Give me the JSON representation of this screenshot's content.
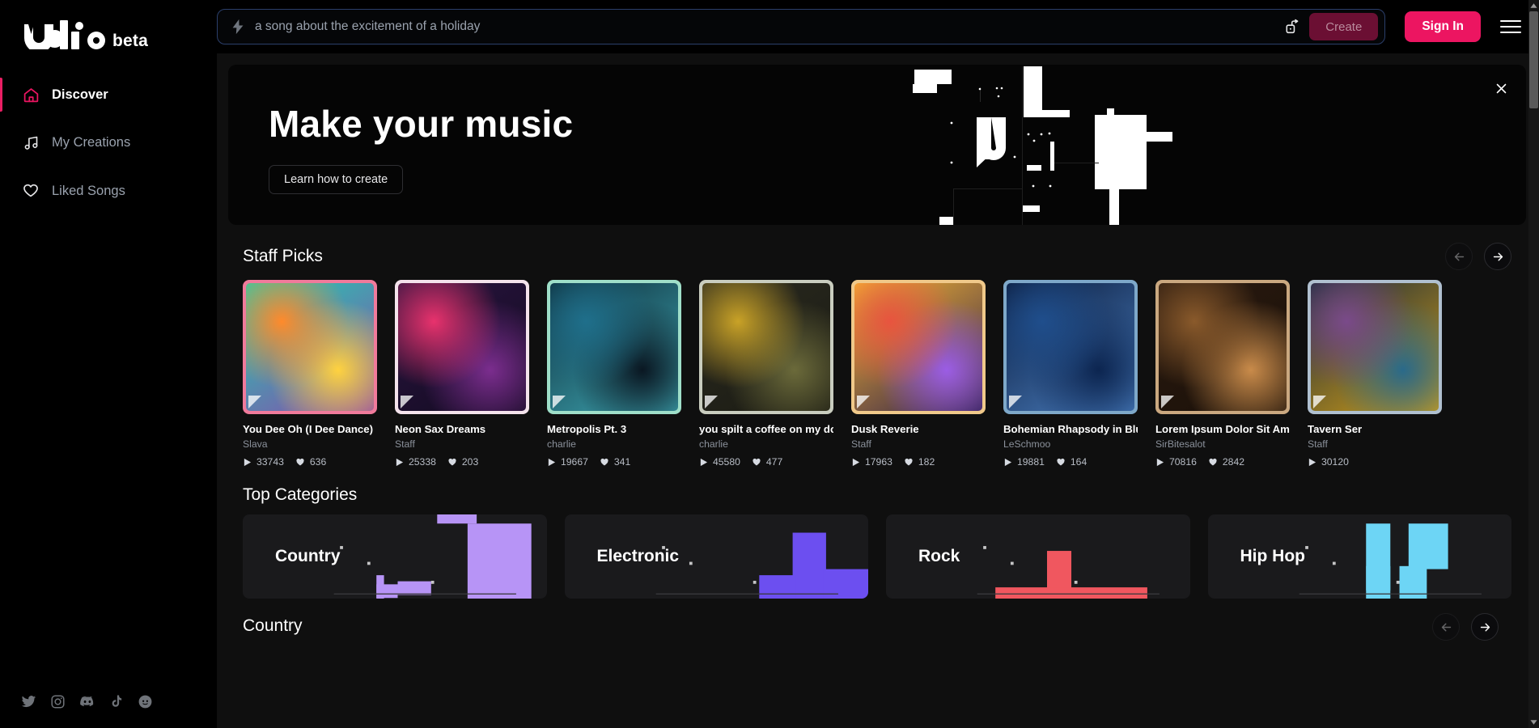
{
  "brand": {
    "name": "udio",
    "tag": "beta",
    "logo_icon": "udio-logo"
  },
  "sidebar": {
    "items": [
      {
        "label": "Discover",
        "icon": "home-icon",
        "active": true
      },
      {
        "label": "My Creations",
        "icon": "music-note-icon",
        "active": false
      },
      {
        "label": "Liked Songs",
        "icon": "heart-icon",
        "active": false
      }
    ],
    "social": [
      {
        "name": "twitter-icon"
      },
      {
        "name": "instagram-icon"
      },
      {
        "name": "discord-icon"
      },
      {
        "name": "tiktok-icon"
      },
      {
        "name": "reddit-icon"
      }
    ]
  },
  "topbar": {
    "prompt_value": "a song about the excitement of a holiday",
    "prompt_placeholder": "a song about the excitement of a holiday",
    "bolt_icon": "lightning-bolt-icon",
    "dice_icon": "dice-shuffle-icon",
    "create_label": "Create",
    "signin_label": "Sign In",
    "menu_icon": "hamburger-menu-icon"
  },
  "hero": {
    "title": "Make your music",
    "button_label": "Learn how to create",
    "close_icon": "close-icon"
  },
  "staff_picks": {
    "title": "Staff Picks",
    "prev_icon": "arrow-left-icon",
    "next_icon": "arrow-right-icon",
    "play_icon": "play-icon",
    "like_icon": "heart-filled-icon",
    "cards": [
      {
        "title": "You Dee Oh (I Dee Dance)",
        "artist": "Slava",
        "plays": "33743",
        "likes": "636",
        "frame": "#f07a9b",
        "g1": "#1dd3b0",
        "g2": "#ff8a2b",
        "g3": "#ffd23f",
        "g4": "#8e44ad"
      },
      {
        "title": "Neon Sax Dreams",
        "artist": "Staff",
        "plays": "25338",
        "likes": "203",
        "frame": "#f4e3ec",
        "g1": "#2a1540",
        "g2": "#e8326d",
        "g3": "#7b2d8e",
        "g4": "#120a20"
      },
      {
        "title": "Metropolis Pt. 3",
        "artist": "charlie",
        "plays": "19667",
        "likes": "341",
        "frame": "#9fdfc9",
        "g1": "#0d2d3a",
        "g2": "#1f6f8b",
        "g3": "#0a1722",
        "g4": "#3fa9b5"
      },
      {
        "title": "you spilt a coffee on my dog",
        "artist": "charlie",
        "plays": "45580",
        "likes": "477",
        "frame": "#c9cdbf",
        "g1": "#2a2a20",
        "g2": "#c9a227",
        "g3": "#6b6a3a",
        "g4": "#1a1a12"
      },
      {
        "title": "Dusk Reverie",
        "artist": "Staff",
        "plays": "17963",
        "likes": "182",
        "frame": "#f0c98a",
        "g1": "#f7b733",
        "g2": "#e8543f",
        "g3": "#9b5de5",
        "g4": "#2a1b4a"
      },
      {
        "title": "Bohemian Rhapsody in Blue",
        "artist": "LeSchmoo",
        "plays": "19881",
        "likes": "164",
        "frame": "#7ea8c9",
        "g1": "#0a1a3a",
        "g2": "#1f4e8c",
        "g3": "#0c2550",
        "g4": "#4a7fc1"
      },
      {
        "title": "Lorem Ipsum Dolor Sit Amet",
        "artist": "SirBitesalot",
        "plays": "70816",
        "likes": "2842",
        "frame": "#caa880",
        "g1": "#2a1a10",
        "g2": "#8a5a2b",
        "g3": "#c98b4a",
        "g4": "#1a1008"
      },
      {
        "title": "Tavern Ser",
        "artist": "Staff",
        "plays": "30120",
        "likes": "",
        "frame": "#b0c0d0",
        "g1": "#1a2a3a",
        "g2": "#7a4a8a",
        "g3": "#2a6a8a",
        "g4": "#d4a017"
      }
    ]
  },
  "top_categories": {
    "title": "Top Categories",
    "cards": [
      {
        "label": "Country",
        "color": "#b794f6"
      },
      {
        "label": "Electronic",
        "color": "#6c4ff0"
      },
      {
        "label": "Rock",
        "color": "#f0575f"
      },
      {
        "label": "Hip Hop",
        "color": "#6dd5f5"
      }
    ]
  },
  "bottom_section": {
    "title": "Country",
    "prev_icon": "arrow-left-icon",
    "next_icon": "arrow-right-icon"
  },
  "colors": {
    "accent_pink": "#ec1561",
    "create_disabled": "#6b0f33",
    "bg": "#000000",
    "panel": "#0f0f0f"
  }
}
